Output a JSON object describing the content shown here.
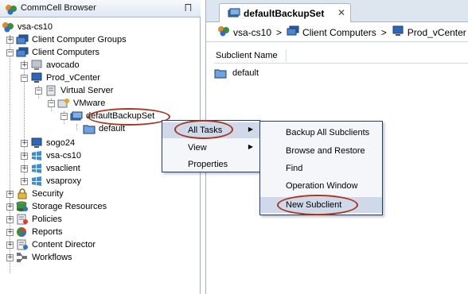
{
  "browser": {
    "title": "CommCell Browser",
    "pin_glyph": "⨅"
  },
  "tree": {
    "root": "vsa-cs10",
    "client_computer_groups": "Client Computer Groups",
    "client_computers": "Client Computers",
    "avocado": "avocado",
    "prod_vcenter": "Prod_vCenter",
    "virtual_server": "Virtual Server",
    "vmware": "VMware",
    "default_backup_set": "defaultBackupSet",
    "default": "default",
    "sogo24": "sogo24",
    "vsa_cs10": "vsa-cs10",
    "vsaclient": "vsaclient",
    "vsaproxy": "vsaproxy",
    "security": "Security",
    "storage_resources": "Storage Resources",
    "policies": "Policies",
    "reports": "Reports",
    "content_director": "Content Director",
    "workflows": "Workflows"
  },
  "tab": {
    "title": "defaultBackupSet",
    "close_glyph": "✕"
  },
  "breadcrumb": {
    "items": [
      "vsa-cs10",
      "Client Computers",
      "Prod_vCenter"
    ],
    "separator": ">"
  },
  "list": {
    "column_header": "Subclient Name",
    "rows": [
      "default"
    ]
  },
  "context_menu": {
    "items": [
      "All Tasks",
      "View",
      "Properties"
    ]
  },
  "submenu": {
    "items": [
      "Backup All Subclients",
      "Browse and Restore",
      "Find",
      "Operation Window",
      "New Subclient"
    ]
  },
  "colors": {
    "highlight_oval": "#a8361f",
    "menu_border": "#1f3f7a",
    "menu_active": "#cfd9ea",
    "header_bg": "#dde5ef"
  }
}
